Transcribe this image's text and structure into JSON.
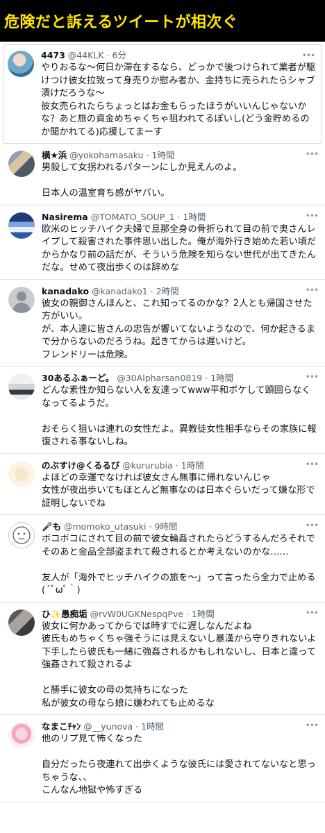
{
  "banner": {
    "title": "危険だと訴えるツイートが相次ぐ"
  },
  "icons": {
    "more": "more-dots-icon"
  },
  "tweets": [
    {
      "name": "4473",
      "handle": "@44KLK",
      "time": "6分",
      "text": "やりおるな〜何日か滞在するなら、どっかで後つけられて業者が駆けつけ彼女拉致って身売りか慰み者か、金持ちに売られたらシャブ漬けだろうな〜\n彼女売られたらちょっとはお金もらったほうがいいんじゃないかな？あと旅の資金めちゃくちゃ狙われてるぽいし(どう金貯めるのか聞かれてる)応援してまーす"
    },
    {
      "name": "横★浜",
      "handle": "@yokohamasaku",
      "time": "1時間",
      "text": "男殺して女拐われるパターンにしか見えんのよ。\n\n日本人の温室育ち感がヤバい。"
    },
    {
      "name": "Nasirema",
      "handle": "@TOMATO_SOUP_1",
      "time": "1時間",
      "text": "欧米のヒッチハイク夫婦で旦那全身の骨折られて目の前で奥さんレイプして殺害された事件思い出した。俺が海外行き始めた若い頃だからかなり前の話だが、そういう危険を知らない世代が出てきたんだな。せめて夜出歩くのは辞めな"
    },
    {
      "name": "kanadako",
      "handle": "@kanadako1",
      "time": "2時間",
      "text": "彼女の親御さんほんと、これ知ってるのかな？2人とも帰国させた方がいい。\nが、本人達に皆さんの忠告が響いてないようなので、何か起きるまで分からないのだろうね。起きてからは遅いけど。\nフレンドリーは危険。"
    },
    {
      "name": "30あるふぁーど。",
      "handle": "@30Alpharsan0819",
      "time": "1時間",
      "text": "どんな素性か知らない人を友達ってwww平和ボケして頭回らなくなってるようだ。\n\nおそらく狙いは連れの女性だよ。異教徒女性相手ならその家族に報復される事ないしね。"
    },
    {
      "name": "のぶすけ@くるるび",
      "handle": "@kururubia",
      "time": "1時間",
      "text": "よほどの幸運でなければ彼女さん無事に帰れないんじゃ\n女性が夜出歩いてもほとんど無事なのは日本ぐらいだって嫌な形で証明しないでね"
    },
    {
      "name": "🎤も",
      "handle": "@momoko_utasuki",
      "time": "9時間",
      "text": "ボコボコにされて目の前で彼女輪姦されたらどうするんだろそれでそのあと金品全部盗まれて殺されるとか考えないのかな……\n\n友人が「海外でヒッチハイクの旅を〜」って言ったら全力で止める(´ﾟωﾟ｀)"
    },
    {
      "name": "ひ✨愚痴垢",
      "handle": "@rvW0UGKNespqPve",
      "time": "1時間",
      "text": "彼女に何かあってからでは時すでに遅しなんだよね\n彼氏もめちゃくちゃ強そうには見えないし暴漢から守りきれないよ\n下手したら彼氏も一緒に強姦されるかもしれないし、日本と違って強姦されて殺されるよ\n\nと勝手に彼女の母の気持ちになった\n私が彼女の母なら娘に嫌われても止めるな"
    },
    {
      "name": "なまこﾁｬﾝ",
      "handle": "@__yunova",
      "time": "1時間",
      "text": "他のリプ見て怖くなった\n\n自分だったら夜連れて出歩くような彼氏には愛されてないなと思っちゃうな、、\nこんなん地獄や怖すぎる"
    }
  ]
}
